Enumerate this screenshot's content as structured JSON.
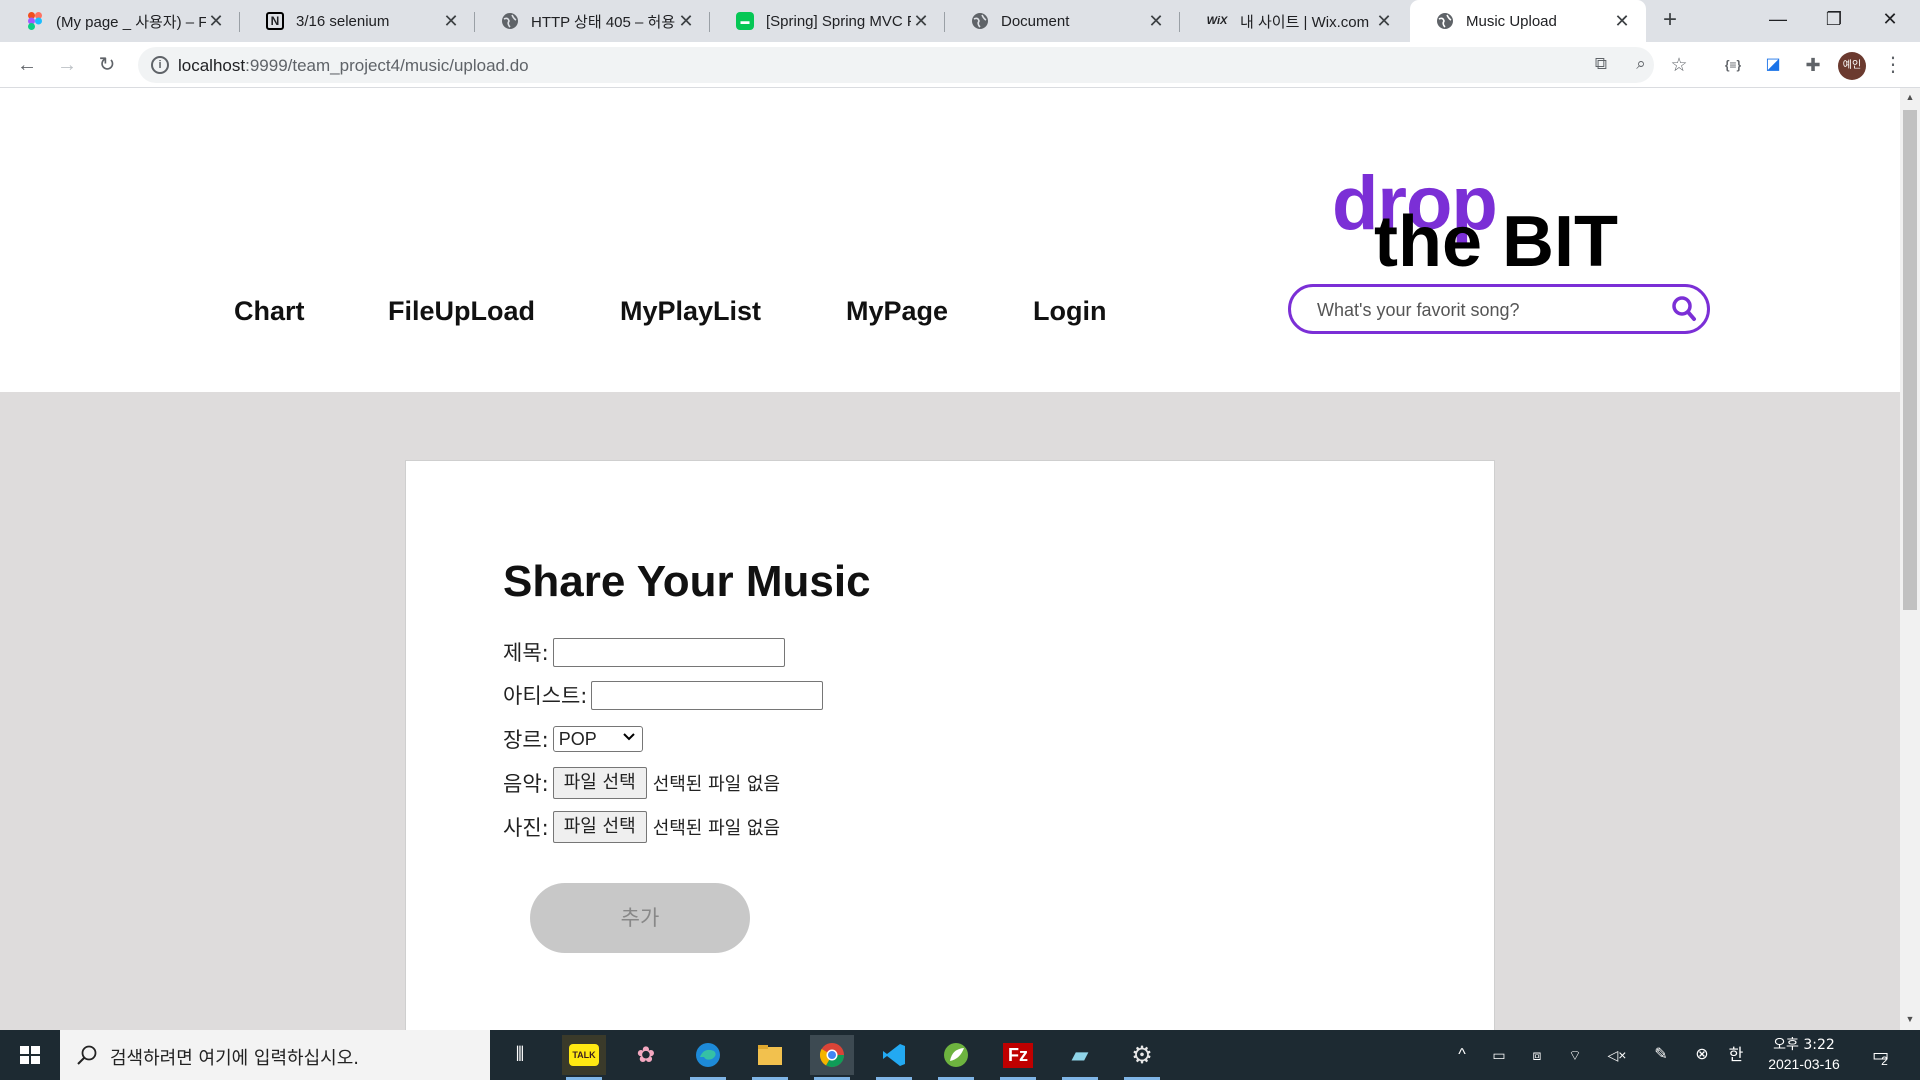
{
  "browser": {
    "tabs": [
      {
        "title": "(My page _ 사용자) – F",
        "icon": "figma-icon"
      },
      {
        "title": "3/16 selenium",
        "icon": "notion-icon"
      },
      {
        "title": "HTTP 상태 405 – 허용",
        "icon": "globe-icon"
      },
      {
        "title": "[Spring] Spring MVC F",
        "icon": "line-icon"
      },
      {
        "title": "Document",
        "icon": "globe-icon"
      },
      {
        "title": "내 사이트 | Wix.com",
        "icon": "wix-icon"
      },
      {
        "title": "Music Upload",
        "icon": "globe-icon"
      }
    ],
    "url_host": "localhost",
    "url_path": ":9999/team_project4/music/upload.do",
    "avatar_text": "예인"
  },
  "site": {
    "logo_top": "drop",
    "logo_bottom": "the BIT",
    "search_placeholder": "What's your favorit song?",
    "nav": [
      "Chart",
      "FileUpLoad",
      "MyPlayList",
      "MyPage",
      "Login"
    ]
  },
  "form": {
    "heading": "Share Your Music",
    "title_label": "제목:",
    "artist_label": "아티스트:",
    "genre_label": "장르:",
    "genre_selected": "POP",
    "music_label": "음악:",
    "photo_label": "사진:",
    "file_button": "파일 선택",
    "no_file": "선택된 파일 없음",
    "submit": "추가"
  },
  "taskbar": {
    "search_text": "검색하려면 여기에 입력하십시오.",
    "ime": "한",
    "time": "오후 3:22",
    "date": "2021-03-16",
    "notifications": "2"
  },
  "colors": {
    "brand_purple": "#7b2fd6",
    "content_bg": "#dedcdc"
  }
}
